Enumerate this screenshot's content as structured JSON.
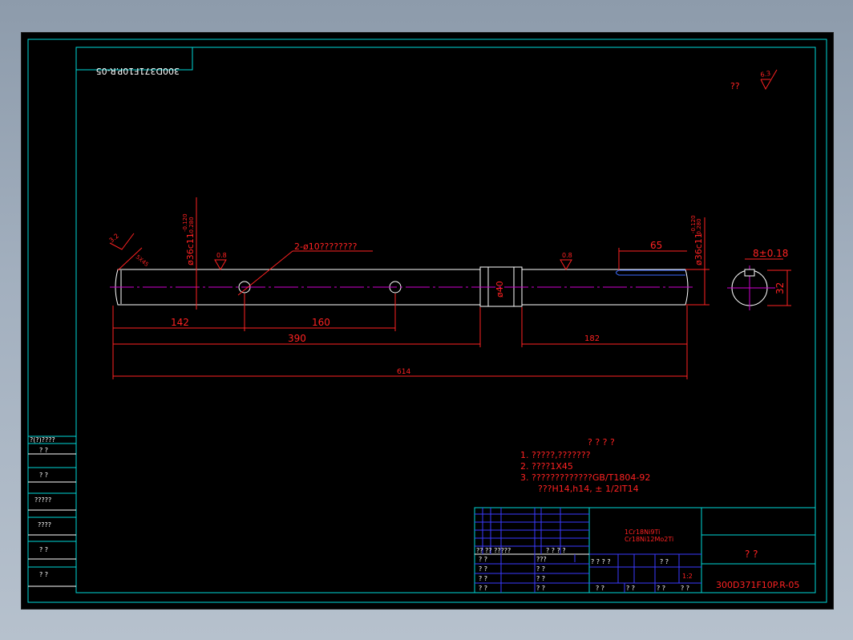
{
  "colors": {
    "background": "#000000",
    "frame": "#00d8d8",
    "geometry": "#ffffff",
    "dimension": "#ff2222",
    "centerline": "#d000d0",
    "titleblock_grid": "#3a3aff",
    "window_bg": "#9aa7b6"
  },
  "drawing": {
    "mirrored_code": "300D371F10P.R-05",
    "top_right_roughness_label": "??",
    "top_right_roughness_value": "6.3",
    "surface_roughness_left": "3.2",
    "surface_roughness_mid_1": "0.8",
    "surface_roughness_mid_2": "0.8",
    "chamfer_note": "5X45",
    "left_diameter_label": "ø36c11",
    "left_diameter_tol": "-0.120\n-0.280",
    "right_diameter_label": "ø36c11",
    "right_diameter_tol": "-0.120\n-0.280",
    "hole_note": "2-ø10????????",
    "collar_diameter": "ø40",
    "keyway_length": "65",
    "key_width": "8±0.18",
    "section_diameter": "32",
    "dim_142": "142",
    "dim_160": "160",
    "dim_390": "390",
    "dim_182": "182",
    "dim_614": "614"
  },
  "notes": {
    "heading": "? ? ? ?",
    "line1": "1. ?????,???????",
    "line2": "2. ????1X45",
    "line3": "3. ?????????????GB/T1804-92",
    "line4": "???H14,h14, ± 1/2IT14"
  },
  "left_column": {
    "header": "?(?)????",
    "rows": [
      "? ?",
      "? ?",
      "?????",
      "????",
      "? ?",
      "? ?"
    ]
  },
  "title_block": {
    "material_line1": "1Cr18Ni9Ti",
    "material_line2": "Cr18Ni12Mo2Ti",
    "name": "? ?",
    "drawing_number": "300D371F10P.R-05",
    "scale": "1:2",
    "row_label_a": "?? ?? ?????",
    "row_label_b": "? ?  ? ?",
    "sig_rows": [
      "? ?",
      "? ?",
      "? ?",
      "? ?"
    ],
    "sig_cols_right": [
      "???",
      "? ?",
      "? ?",
      "? ?"
    ],
    "stage_header": "? ? ? ?",
    "weight_header": "? ?",
    "bottom_cells": [
      "? ?",
      "? ?",
      "? ?",
      "? ?"
    ]
  }
}
